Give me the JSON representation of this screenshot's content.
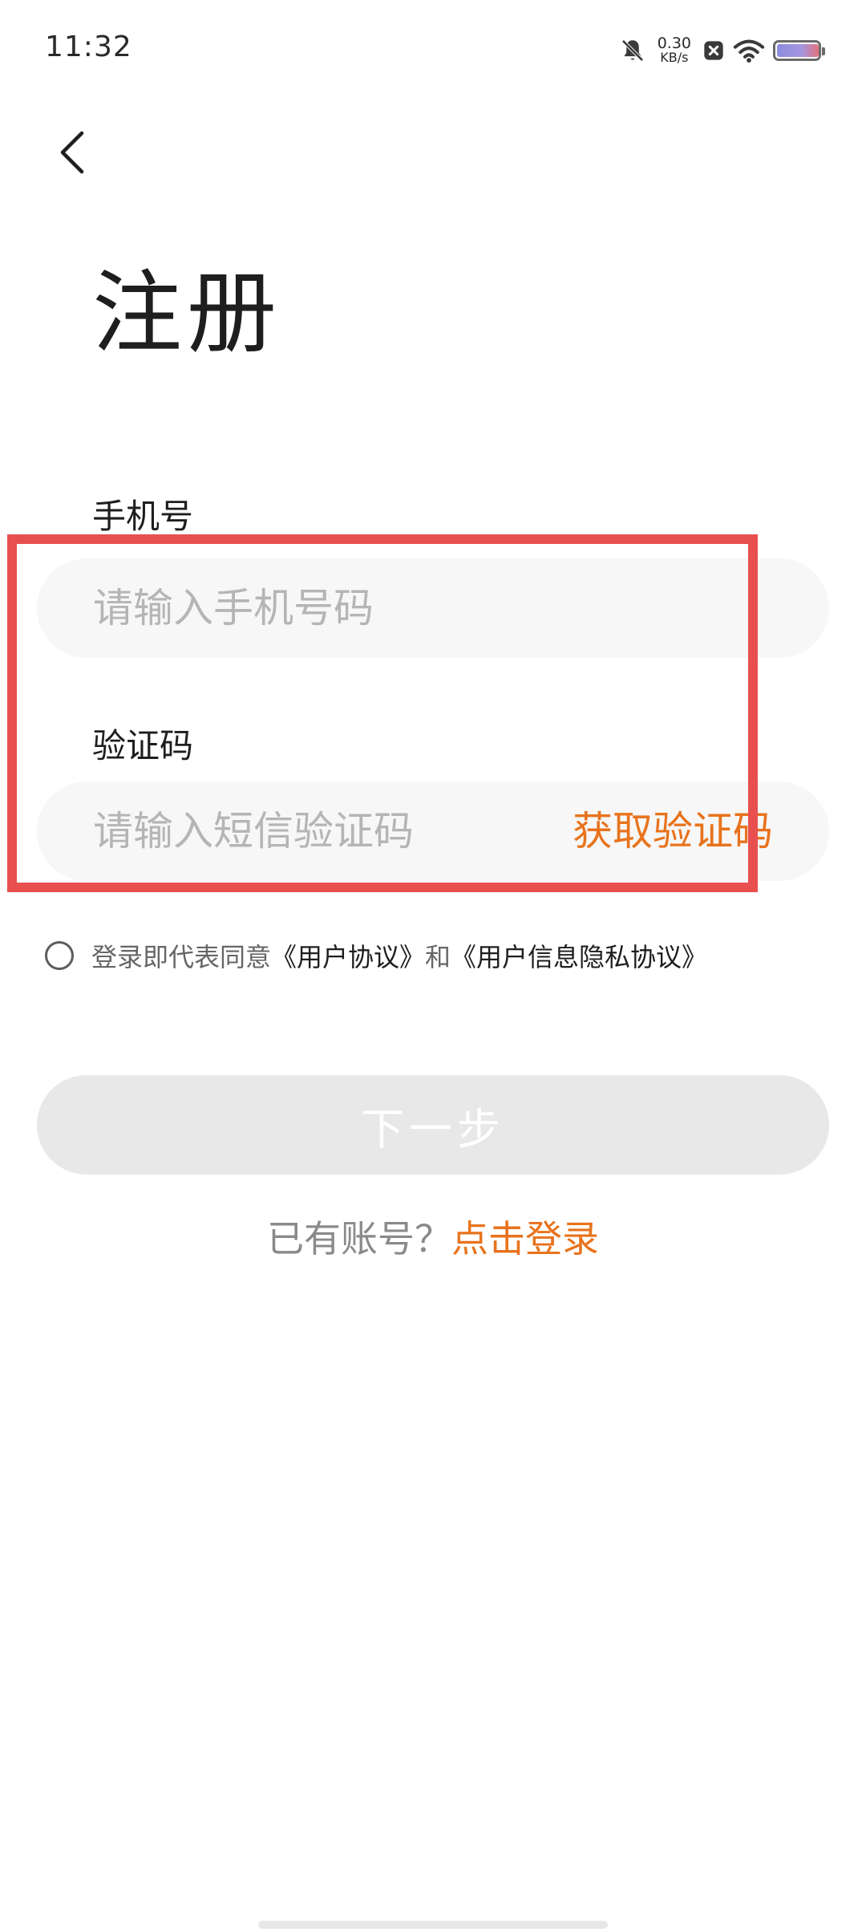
{
  "status_bar": {
    "time": "11:32",
    "net_speed_value": "0.30",
    "net_speed_unit": "KB/s",
    "icons": [
      "bell-muted-icon",
      "close-box-icon",
      "wifi-icon",
      "battery-icon"
    ]
  },
  "header": {
    "back_icon": "chevron-left-icon",
    "title": "注册"
  },
  "form": {
    "phone_label": "手机号",
    "phone_placeholder": "请输入手机号码",
    "phone_value": "",
    "code_label": "验证码",
    "code_placeholder": "请输入短信验证码",
    "code_value": "",
    "get_code_label": "获取验证码"
  },
  "agreement": {
    "checked": false,
    "prefix": "登录即代表同意",
    "user_agreement": "《用户协议》",
    "connector": "和",
    "privacy_agreement": "《用户信息隐私协议》"
  },
  "actions": {
    "next_label": "下一步",
    "login_prompt": "已有账号？",
    "login_link": "点击登录"
  },
  "colors": {
    "accent": "#e8731d",
    "highlight": "#e84f4f",
    "input_bg": "#f7f7f7",
    "button_disabled_bg": "#e8e8e8"
  }
}
